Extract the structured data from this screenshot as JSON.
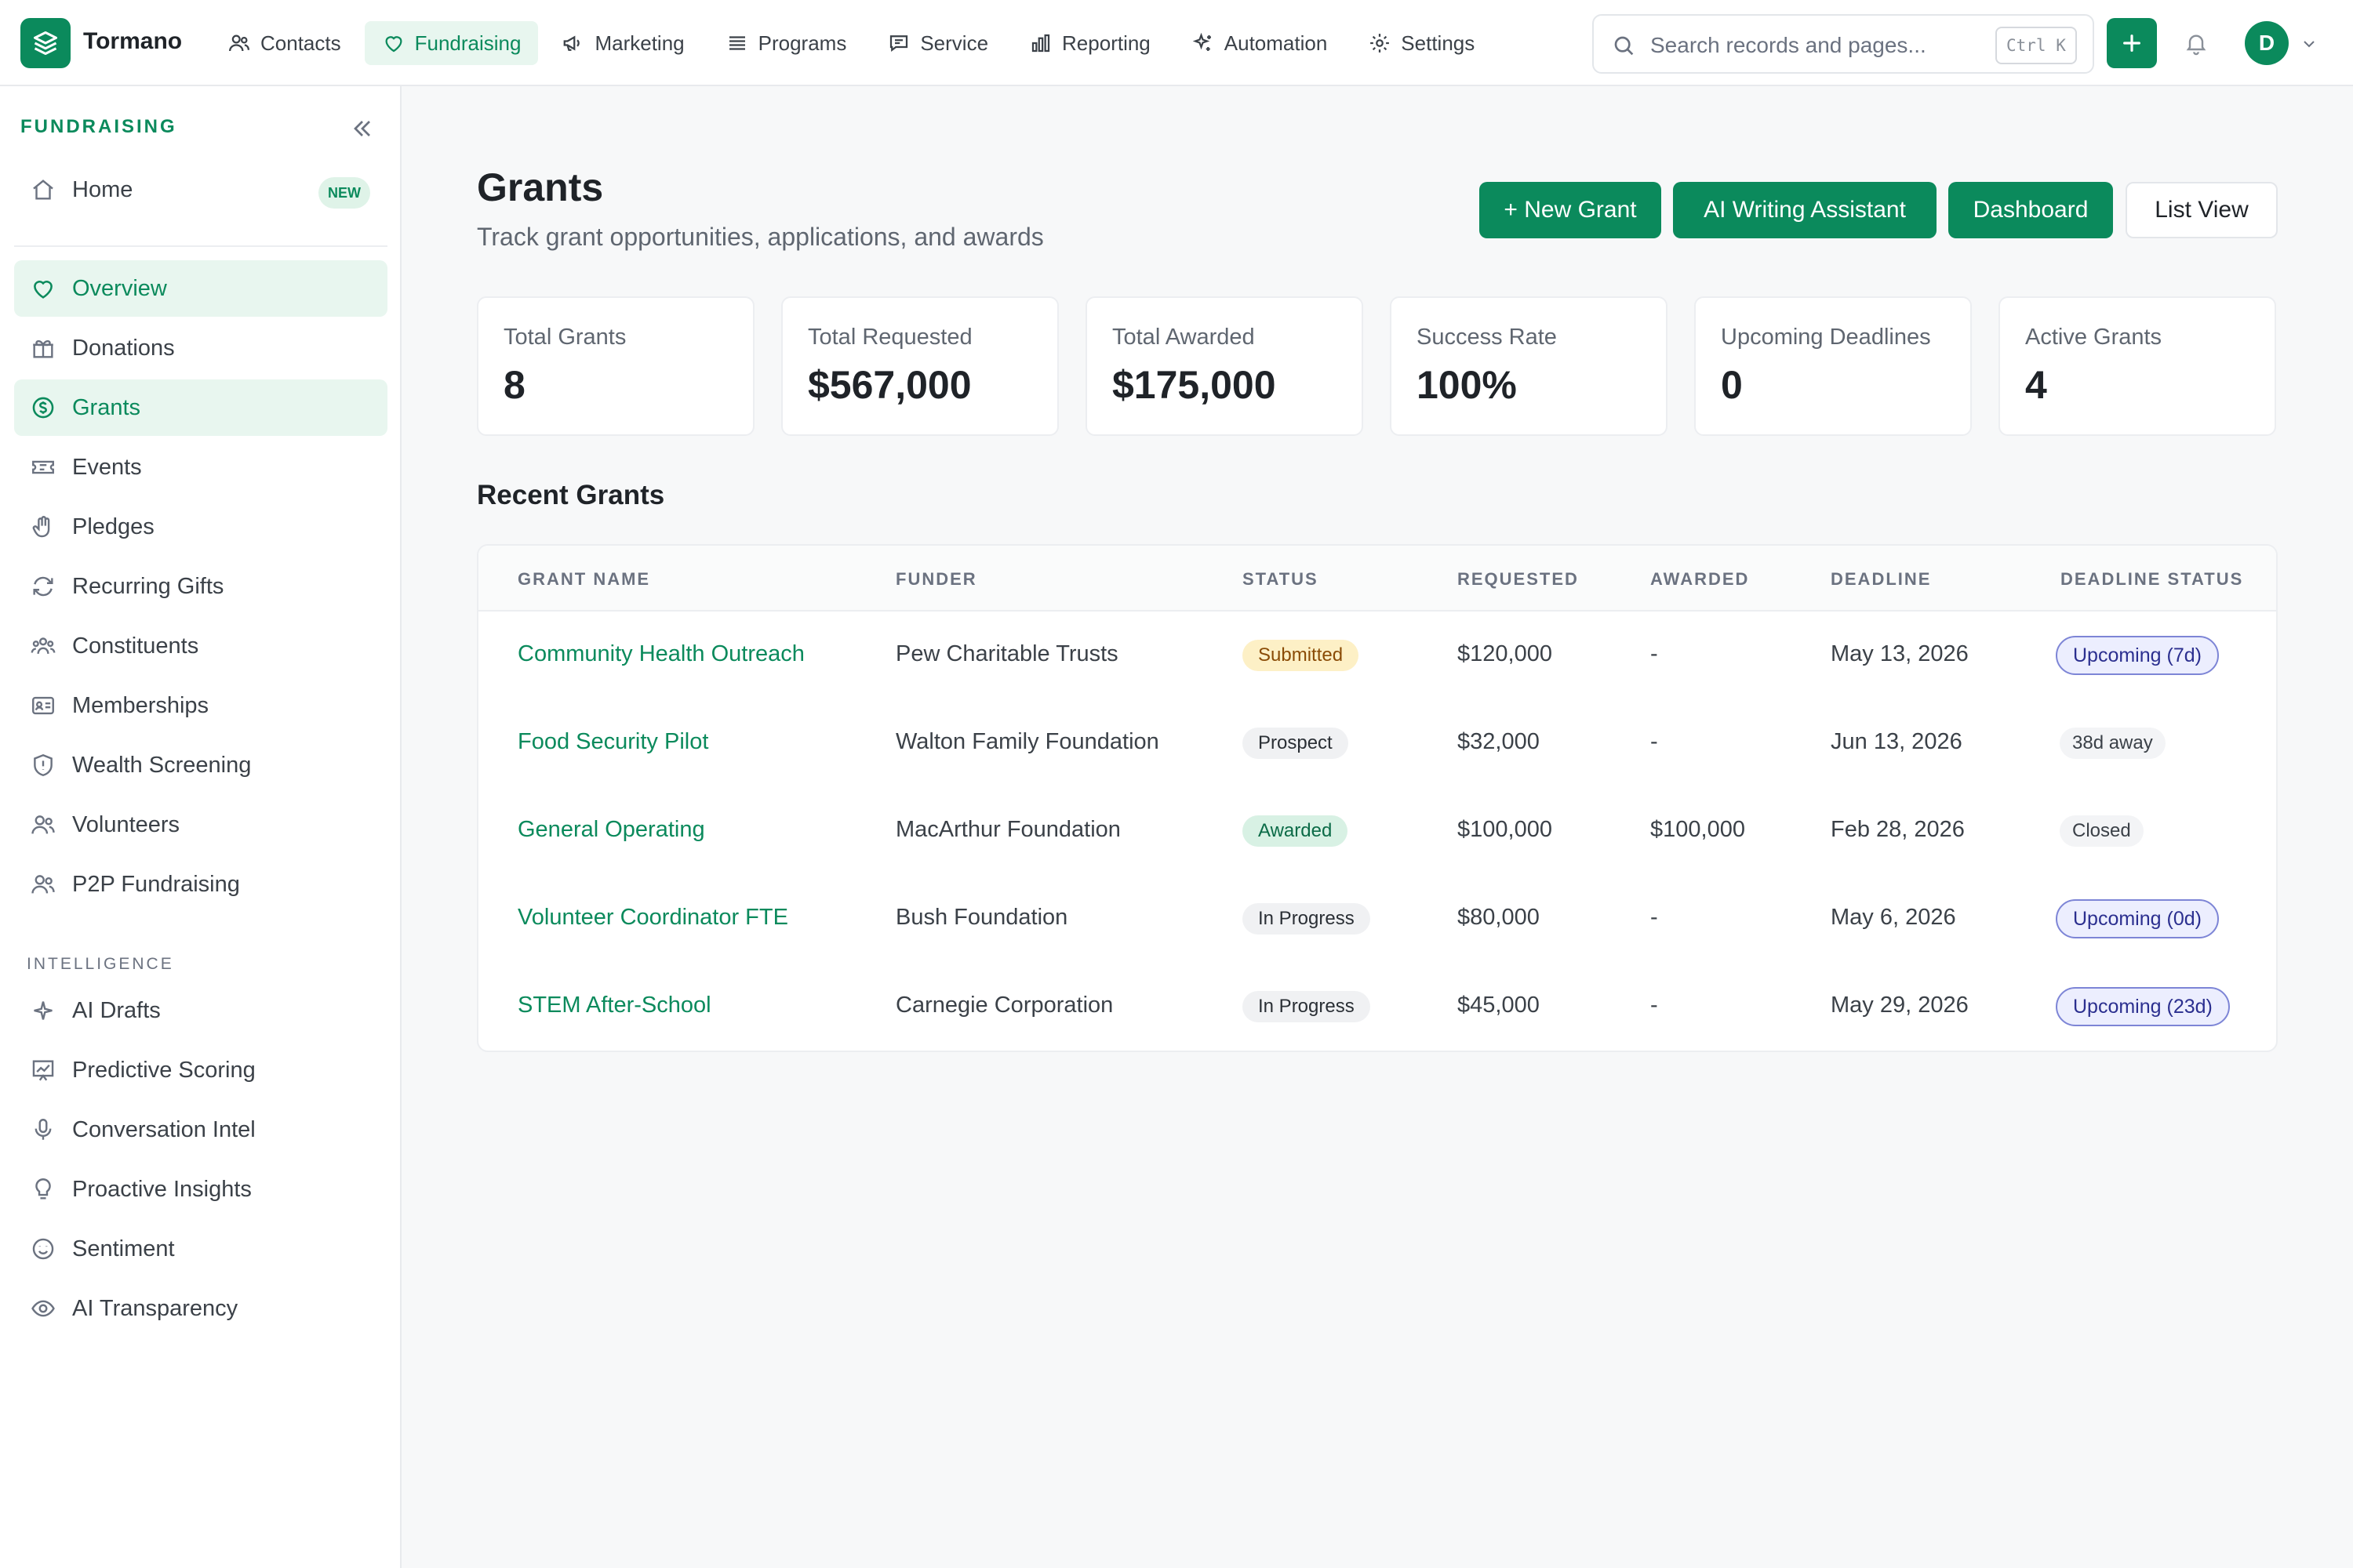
{
  "brand": {
    "name": "Tormano"
  },
  "nav": [
    {
      "label": "Contacts",
      "icon": "users-icon"
    },
    {
      "label": "Fundraising",
      "icon": "heart-icon",
      "active": true
    },
    {
      "label": "Marketing",
      "icon": "megaphone-icon"
    },
    {
      "label": "Programs",
      "icon": "list-icon"
    },
    {
      "label": "Service",
      "icon": "chat-icon"
    },
    {
      "label": "Reporting",
      "icon": "bar-chart-icon"
    },
    {
      "label": "Automation",
      "icon": "sparkle-icon"
    },
    {
      "label": "Settings",
      "icon": "gear-icon"
    }
  ],
  "search": {
    "placeholder": "Search records and pages...",
    "shortcut": "Ctrl K"
  },
  "user": {
    "initial": "D"
  },
  "sidebar": {
    "title": "FUNDRAISING",
    "home": {
      "label": "Home",
      "badge": "NEW"
    },
    "items": [
      {
        "label": "Overview",
        "icon": "heart-icon"
      },
      {
        "label": "Donations",
        "icon": "gift-icon"
      },
      {
        "label": "Grants",
        "icon": "dollar-circle-icon"
      },
      {
        "label": "Events",
        "icon": "ticket-icon"
      },
      {
        "label": "Pledges",
        "icon": "hand-icon"
      },
      {
        "label": "Recurring Gifts",
        "icon": "refresh-icon"
      },
      {
        "label": "Constituents",
        "icon": "people-group-icon"
      },
      {
        "label": "Memberships",
        "icon": "id-card-icon"
      },
      {
        "label": "Wealth Screening",
        "icon": "shield-icon"
      },
      {
        "label": "Volunteers",
        "icon": "users-icon"
      },
      {
        "label": "P2P Fundraising",
        "icon": "users-icon"
      }
    ],
    "section_label": "INTELLIGENCE",
    "intel_items": [
      {
        "label": "AI Drafts",
        "icon": "sparkle-icon"
      },
      {
        "label": "Predictive Scoring",
        "icon": "trend-chart-icon"
      },
      {
        "label": "Conversation Intel",
        "icon": "microphone-icon"
      },
      {
        "label": "Proactive Insights",
        "icon": "lightbulb-icon"
      },
      {
        "label": "Sentiment",
        "icon": "smile-icon"
      },
      {
        "label": "AI Transparency",
        "icon": "eye-icon"
      }
    ]
  },
  "page": {
    "title": "Grants",
    "subtitle": "Track grant opportunities, applications, and awards",
    "buttons": {
      "new_grant": "+ New Grant",
      "ai_writing": "AI Writing Assistant",
      "dashboard": "Dashboard",
      "list_view": "List View"
    }
  },
  "stats": [
    {
      "label": "Total Grants",
      "value": "8"
    },
    {
      "label": "Total Requested",
      "value": "$567,000"
    },
    {
      "label": "Total Awarded",
      "value": "$175,000"
    },
    {
      "label": "Success Rate",
      "value": "100%"
    },
    {
      "label": "Upcoming Deadlines",
      "value": "0"
    },
    {
      "label": "Active Grants",
      "value": "4"
    }
  ],
  "recent": {
    "title": "Recent Grants",
    "columns": [
      "GRANT NAME",
      "FUNDER",
      "STATUS",
      "REQUESTED",
      "AWARDED",
      "DEADLINE",
      "DEADLINE STATUS"
    ],
    "rows": [
      {
        "name": "Community Health Outreach",
        "funder": "Pew Charitable Trusts",
        "status": "Submitted",
        "status_kind": "submitted",
        "requested": "$120,000",
        "awarded": "-",
        "deadline": "May 13, 2026",
        "deadline_status": "Upcoming (7d)",
        "ds_kind": "upcoming"
      },
      {
        "name": "Food Security Pilot",
        "funder": "Walton Family Foundation",
        "status": "Prospect",
        "status_kind": "neutral",
        "requested": "$32,000",
        "awarded": "-",
        "deadline": "Jun 13, 2026",
        "deadline_status": "38d away",
        "ds_kind": "plain"
      },
      {
        "name": "General Operating",
        "funder": "MacArthur Foundation",
        "status": "Awarded",
        "status_kind": "awarded",
        "requested": "$100,000",
        "awarded": "$100,000",
        "deadline": "Feb 28, 2026",
        "deadline_status": "Closed",
        "ds_kind": "plain"
      },
      {
        "name": "Volunteer Coordinator FTE",
        "funder": "Bush Foundation",
        "status": "In Progress",
        "status_kind": "neutral",
        "requested": "$80,000",
        "awarded": "-",
        "deadline": "May 6, 2026",
        "deadline_status": "Upcoming (0d)",
        "ds_kind": "upcoming"
      },
      {
        "name": "STEM After-School",
        "funder": "Carnegie Corporation",
        "status": "In Progress",
        "status_kind": "neutral",
        "requested": "$45,000",
        "awarded": "-",
        "deadline": "May 29, 2026",
        "deadline_status": "Upcoming (23d)",
        "ds_kind": "upcoming"
      }
    ]
  },
  "colors": {
    "accent": "#0b8a5c",
    "accent_soft": "#e8f6ef"
  }
}
